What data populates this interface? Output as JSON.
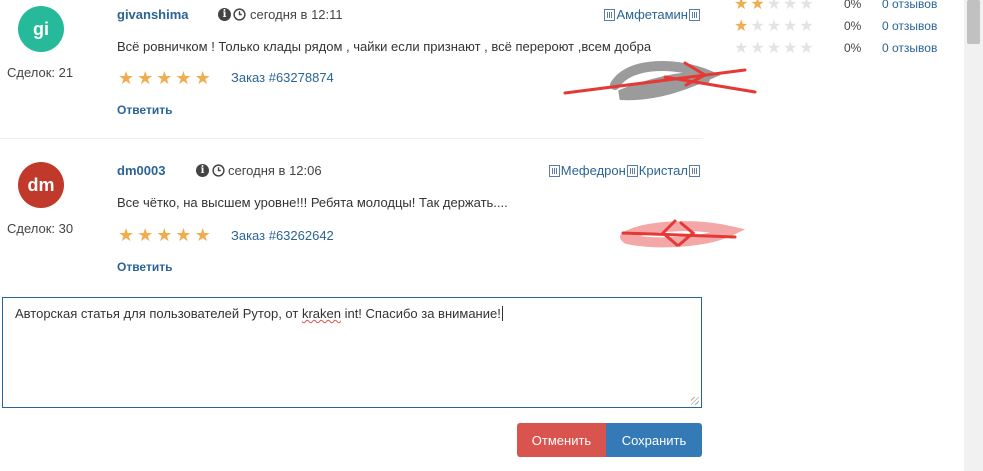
{
  "reviews": [
    {
      "avatar_initials": "gi",
      "avatar_color": "#26b99a",
      "deals": "Сделок: 21",
      "username": "givanshima",
      "date": "сегодня в 12:11",
      "products": [
        "Амфетамин"
      ],
      "text": "Всё ровничком ! Только клады рядом , чайки если признают , всё перероют ,всем добра",
      "rating": 5,
      "order": "Заказ #63278874",
      "reply_label": "Ответить"
    },
    {
      "avatar_initials": "dm",
      "avatar_color": "#c0392b",
      "deals": "Сделок: 30",
      "username": "dm0003",
      "date": "сегодня в 12:06",
      "products": [
        "Мефедрон",
        "Кристал"
      ],
      "text": "Все чётко, на высшем уровне!!! Ребята молодцы! Так держать....",
      "rating": 5,
      "order": "Заказ #63262642",
      "reply_label": "Ответить"
    }
  ],
  "rating_breakdown": [
    {
      "stars": 2,
      "percent": "0%",
      "count": "0 отзывов"
    },
    {
      "stars": 1,
      "percent": "0%",
      "count": "0 отзывов"
    },
    {
      "stars": 0,
      "percent": "0%",
      "count": "0 отзывов"
    }
  ],
  "editor": {
    "text_before": "Авторская статья для пользователей Рутор, от ",
    "text_misspelled": "kraken",
    "text_after": " int! Спасибо за внимание!"
  },
  "buttons": {
    "cancel": "Отменить",
    "save": "Сохранить"
  },
  "colors": {
    "link": "#2a6496",
    "star": "#f0ad4e",
    "cancel": "#d9534f",
    "save": "#337ab7",
    "annotation_red": "#e53935"
  },
  "icons": [
    "info-icon",
    "clock-icon",
    "qr-code-icon",
    "star-icon",
    "resize-grip-icon"
  ]
}
